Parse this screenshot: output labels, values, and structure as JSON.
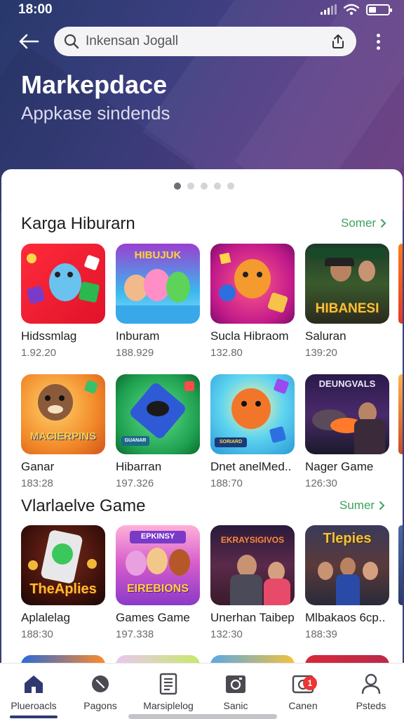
{
  "status": {
    "time": "18:00"
  },
  "search": {
    "placeholder": "Inkensan Jogall"
  },
  "header": {
    "title": "Markepdace",
    "subtitle": "Appkase sindends"
  },
  "carousel": {
    "active_index": 0,
    "count": 5
  },
  "sections": [
    {
      "title": "Karga Hiburarn",
      "more_label": "Somer",
      "rows": [
        [
          {
            "name": "Hidssmlag",
            "meta": "1.92.20",
            "art_text": ""
          },
          {
            "name": "Inburam",
            "meta": "188.929",
            "art_text": "HIBUJUK"
          },
          {
            "name": "Sucla Hibraom",
            "meta": "132.80",
            "art_text": ""
          },
          {
            "name": "Saluran",
            "meta": "139:20",
            "art_text": "HIBANESI"
          }
        ],
        [
          {
            "name": "Ganar",
            "meta": "183:28",
            "art_text": "MACIERPINS"
          },
          {
            "name": "Hibarran",
            "meta": "197.326",
            "art_text": "GUANAR"
          },
          {
            "name": "Dnet anelMed..",
            "meta": "188:70",
            "art_text": "SORIARD"
          },
          {
            "name": "Nager Game",
            "meta": "126:30",
            "art_text": "DEUNGVALS"
          }
        ]
      ]
    },
    {
      "title": "Vlarlaelve Game",
      "more_label": "Sumer",
      "rows": [
        [
          {
            "name": "Aplalelag",
            "meta": "188:30",
            "art_text": "TheAplies"
          },
          {
            "name": "Games Game",
            "meta": "197.338",
            "art_text": "EIREBIONS"
          },
          {
            "name": "Unerhan Taibep",
            "meta": "132:30",
            "art_text": "EKRAYSIGIVOS"
          },
          {
            "name": "Mlbakaos 6cp..",
            "meta": "188:39",
            "art_text": "Tlepies"
          }
        ]
      ]
    }
  ],
  "nav": [
    {
      "label": "Plueroacls",
      "icon": "home-icon"
    },
    {
      "label": "Pagons",
      "icon": "pen-icon"
    },
    {
      "label": "Marsiplelog",
      "icon": "document-icon"
    },
    {
      "label": "Sanic",
      "icon": "camera-icon"
    },
    {
      "label": "Canen",
      "icon": "image-icon",
      "badge": "1"
    },
    {
      "label": "Psteds",
      "icon": "person-icon"
    }
  ],
  "colors": {
    "accent_green": "#3aa35a",
    "nav_active": "#2f3a72",
    "hero": "#3d3f80"
  }
}
